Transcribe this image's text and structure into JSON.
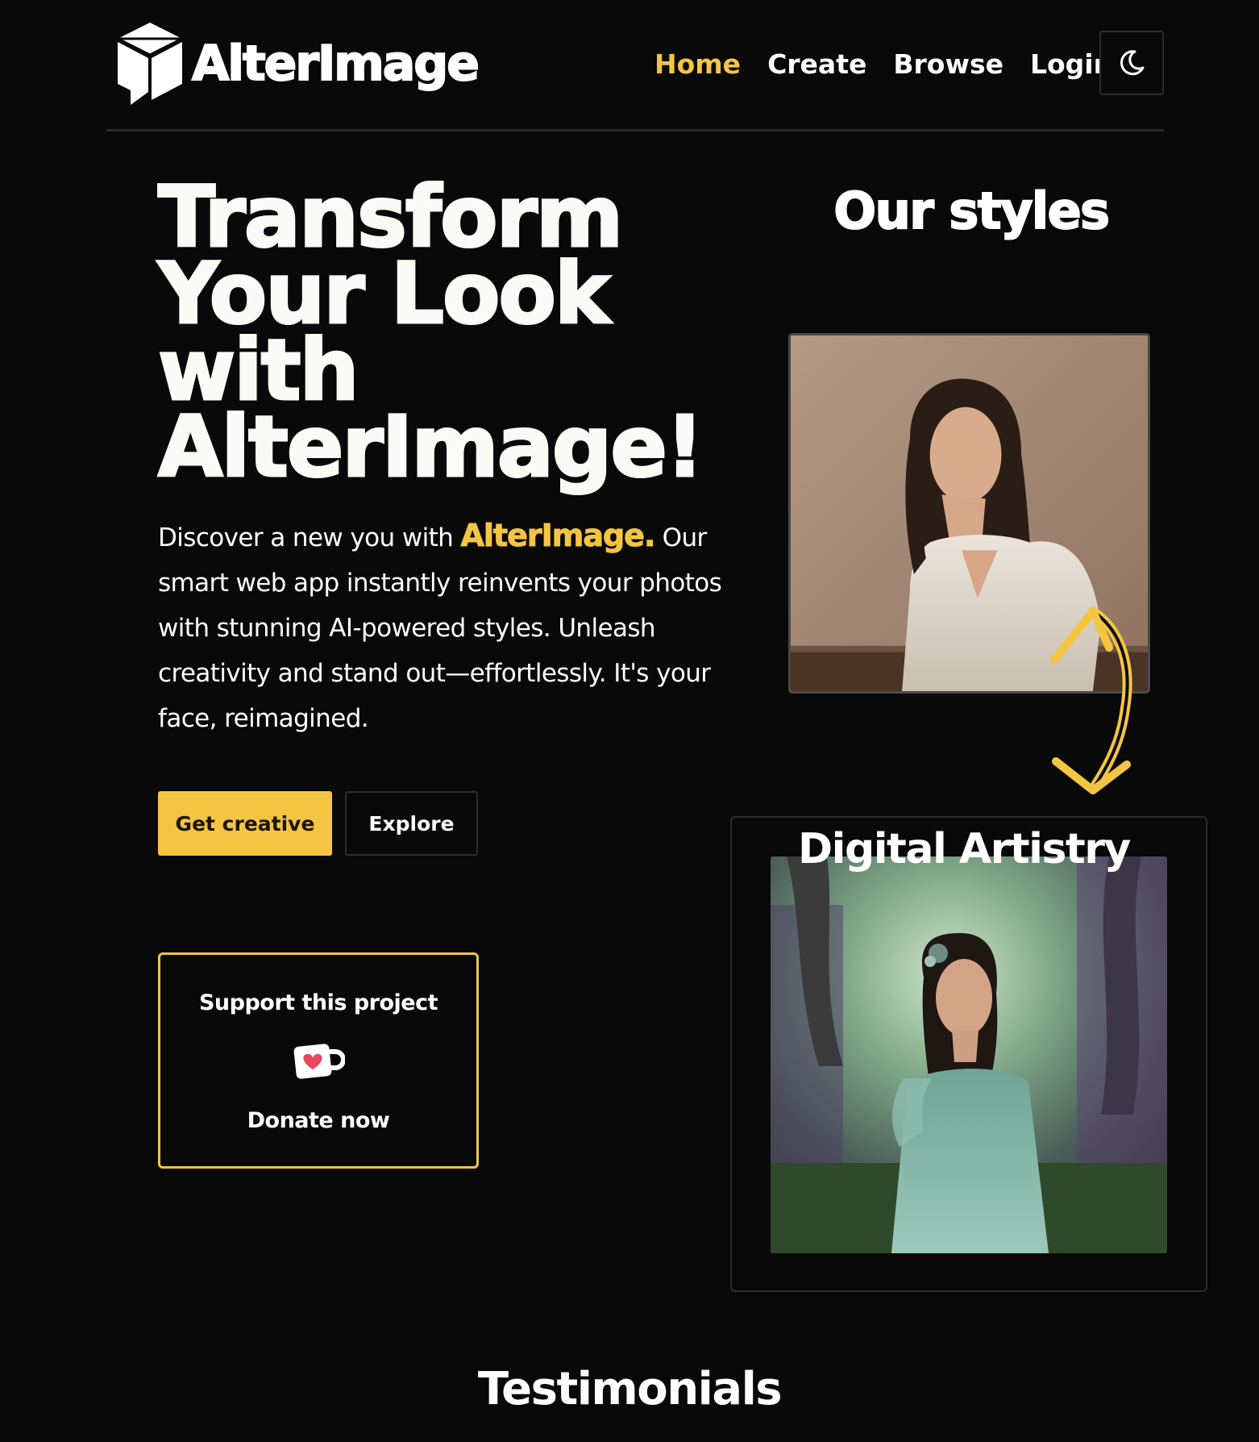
{
  "brand": {
    "name": "AlterImage"
  },
  "nav": {
    "links": [
      {
        "label": "Home",
        "active": true
      },
      {
        "label": "Create",
        "active": false
      },
      {
        "label": "Browse",
        "active": false
      },
      {
        "label": "Login",
        "active": false
      }
    ],
    "theme_toggle_icon": "moon-icon"
  },
  "hero": {
    "title_lines": [
      "Transform",
      "Your Look",
      "with",
      "AlterImage!"
    ],
    "copy_lead": "Discover a new you with ",
    "copy_brand": "AlterImage.",
    "copy_body": "Our smart web app instantly reinvents your photos with stunning AI-powered styles. Unleash creativity and stand out—effortlessly. It's your face, reimagined.",
    "primary_cta": "Get creative",
    "secondary_cta": "Explore"
  },
  "support": {
    "title": "Support this project",
    "cta": "Donate now",
    "icon": "coffee-cup-heart-icon"
  },
  "styles": {
    "title": "Our styles",
    "current_style": "Digital Artistry",
    "arrow_icon": "curved-arrow-down-icon"
  },
  "testimonials": {
    "title": "Testimonials"
  },
  "colors": {
    "background": "#0a0909",
    "accent": "#f4c542",
    "text": "#ffffff",
    "border": "#2d2d2d"
  }
}
